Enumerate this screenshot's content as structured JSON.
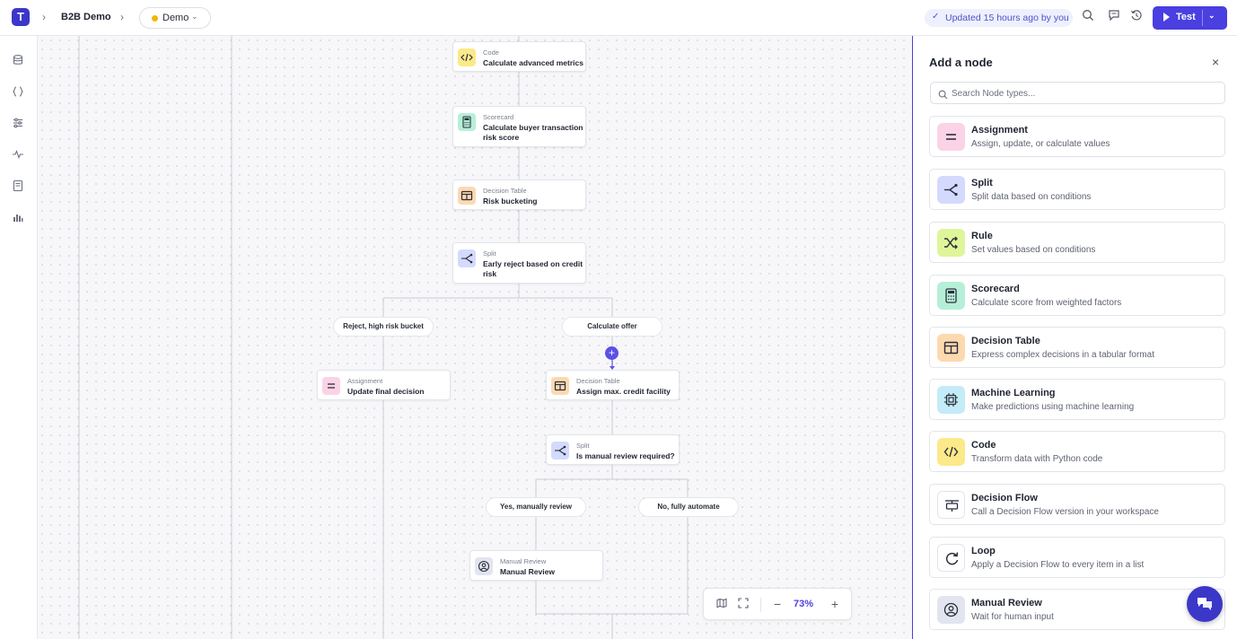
{
  "header": {
    "logo_letter": "T",
    "project_name": "B2B Demo",
    "environment": "Demo",
    "updated_text": "Updated 15 hours ago by you",
    "test_label": "Test"
  },
  "icons": [
    "database-icon",
    "braces-icon",
    "sliders-icon",
    "activity-icon",
    "book-icon",
    "bar-chart-icon",
    "search-icon",
    "comment-icon",
    "history-icon",
    "map-icon",
    "fit-view-icon",
    "chat-icon"
  ],
  "canvas": {
    "nodes": [
      {
        "type": "Code",
        "title": "Calculate advanced metrics"
      },
      {
        "type": "Scorecard",
        "title": "Calculate buyer transaction risk score"
      },
      {
        "type": "Decision Table",
        "title": "Risk bucketing"
      },
      {
        "type": "Split",
        "title": "Early reject based on credit risk"
      },
      {
        "type": "Assignment",
        "title": "Update final decision"
      },
      {
        "type": "Decision Table",
        "title": "Assign max. credit facility"
      },
      {
        "type": "Split",
        "title": "Is manual review required?"
      },
      {
        "type": "Manual Review",
        "title": "Manual Review"
      }
    ],
    "branch_labels": [
      "Reject, high risk bucket",
      "Calculate offer",
      "Yes, manually review",
      "No, fully automate"
    ],
    "zoom": {
      "minus": "−",
      "plus": "+",
      "value": "73%"
    }
  },
  "panel": {
    "title": "Add a node",
    "close": "×",
    "search_placeholder": "Search Node types...",
    "node_types": [
      {
        "name": "Assignment",
        "desc": "Assign, update, or calculate values",
        "color": "#fbd3e6"
      },
      {
        "name": "Split",
        "desc": "Split data based on conditions",
        "color": "#d4dafd"
      },
      {
        "name": "Rule",
        "desc": "Set values based on conditions",
        "color": "#dff59a"
      },
      {
        "name": "Scorecard",
        "desc": "Calculate score from weighted factors",
        "color": "#b6efd7"
      },
      {
        "name": "Decision Table",
        "desc": "Express complex decisions in a tabular format",
        "color": "#fdd9b0"
      },
      {
        "name": "Machine Learning",
        "desc": "Make predictions using machine learning",
        "color": "#c4ebf8"
      },
      {
        "name": "Code",
        "desc": "Transform data with Python code",
        "color": "#fbe98a"
      },
      {
        "name": "Decision Flow",
        "desc": "Call a Decision Flow version in your workspace",
        "color": "#ffffff"
      },
      {
        "name": "Loop",
        "desc": "Apply a Decision Flow to every item in a list",
        "color": "#ffffff"
      },
      {
        "name": "Manual Review",
        "desc": "Wait for human input",
        "color": "#e2e5ef"
      }
    ]
  }
}
